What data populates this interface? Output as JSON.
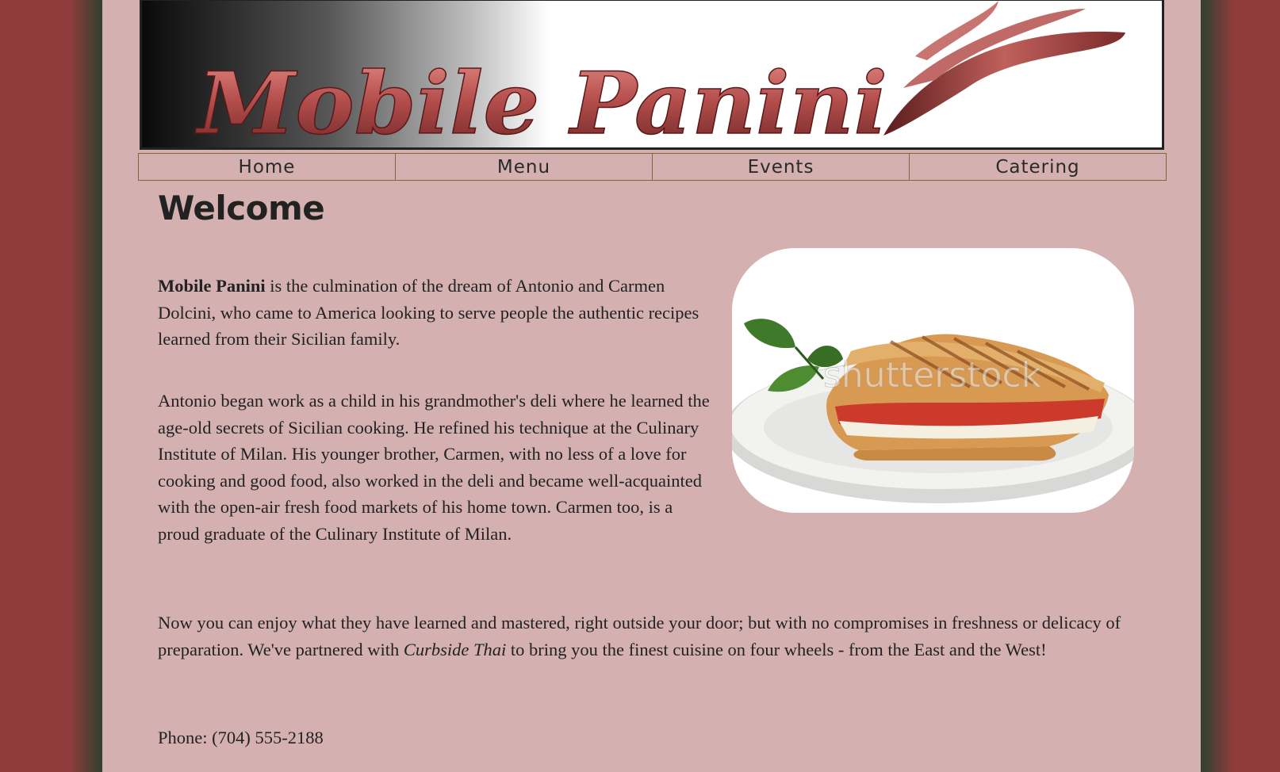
{
  "banner": {
    "logo_text": "Mobile Panini"
  },
  "nav": {
    "items": [
      {
        "label": "Home"
      },
      {
        "label": "Menu"
      },
      {
        "label": "Events"
      },
      {
        "label": "Catering"
      }
    ]
  },
  "main": {
    "heading": "Welcome",
    "p1": {
      "brand": "Mobile Panini",
      "text": " is the culmination of the dream of Antonio and Carmen Dolcini, who came to America looking to serve people the authentic recipes learned from their Sicilian family."
    },
    "p2": "Antonio began work as a child in his grandmother's deli where he learned the age-old secrets of Sicilian cooking. He refined his technique at the Culinary Institute of Milan. His younger brother, Carmen, with no less of a love for cooking and good food, also worked in the deli and became well-acquainted with the open-air fresh food markets of his home town. Carmen too, is a proud graduate of the Culinary Institute of Milan.",
    "p3": {
      "before": "Now you can enjoy what they have learned and mastered, right outside your door; but with no compromises in freshness or delicacy of preparation. We've partnered with ",
      "partner": "Curbside Thai",
      "after": " to bring you the finest cuisine on four wheels - from the East and the West!"
    },
    "phone": "Phone: (704) 555-2188",
    "photo": {
      "watermark": "shutterstock"
    }
  },
  "colors": {
    "outer_red": "#913c3c",
    "outer_dark": "#3a4030",
    "page_pink": "#d4b0b0",
    "logo_red": "#b5504e"
  }
}
